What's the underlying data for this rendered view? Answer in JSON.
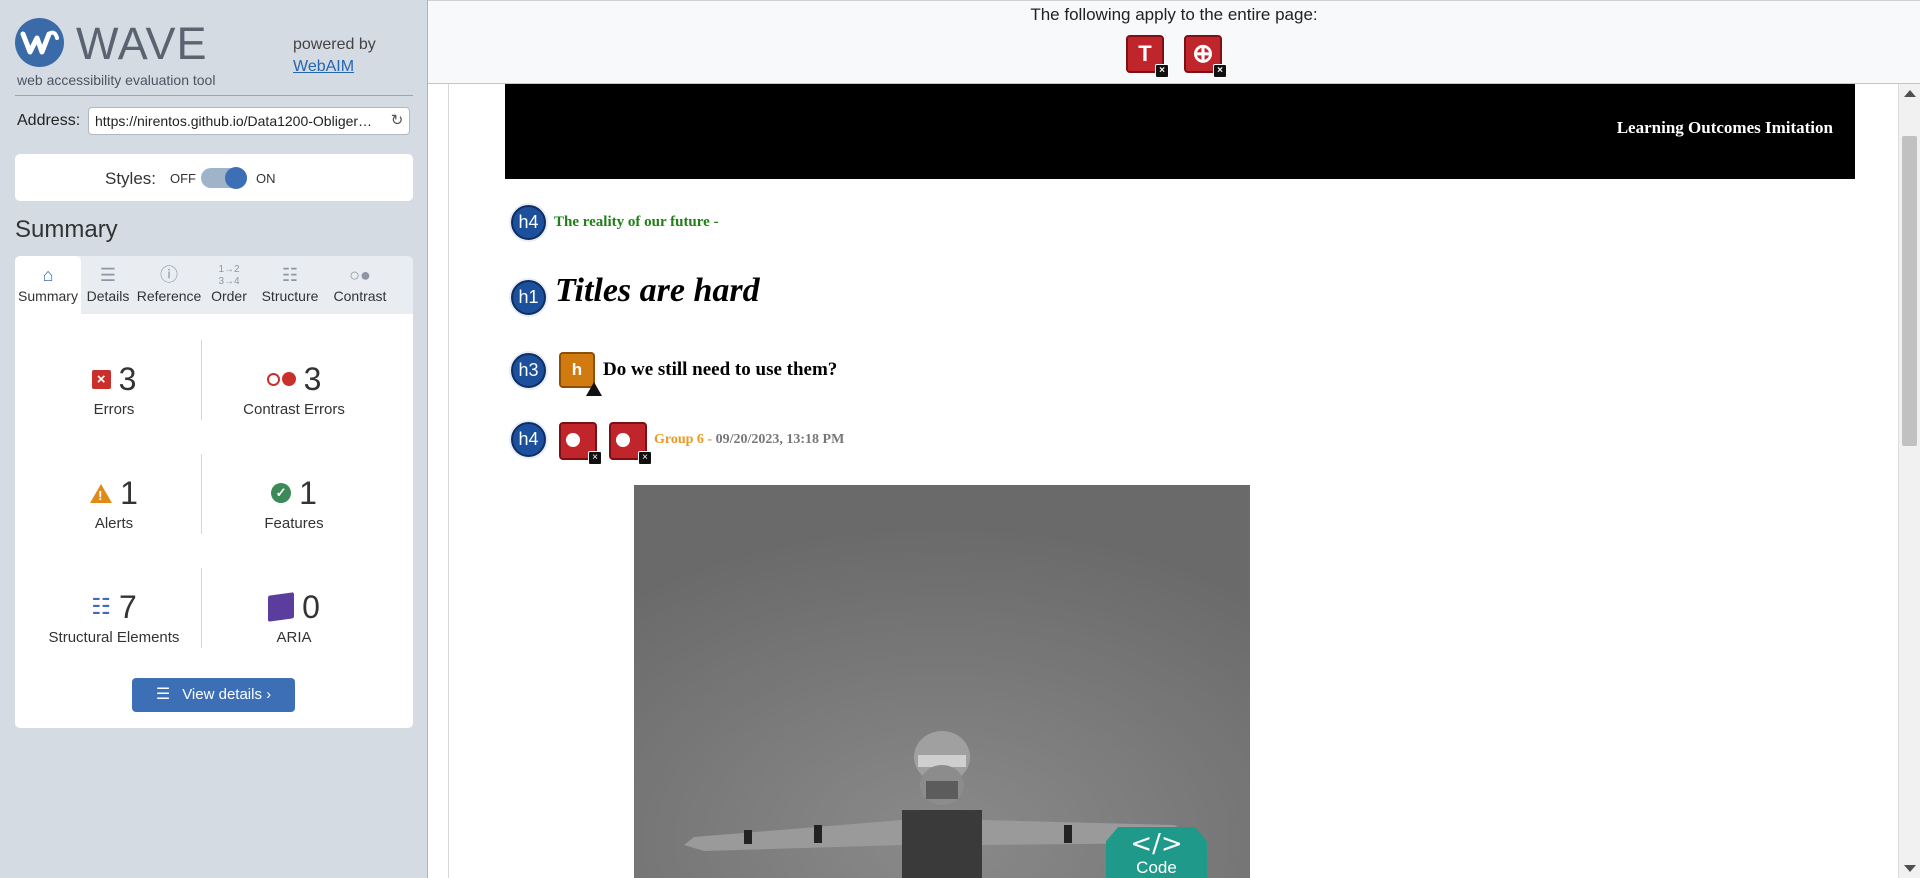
{
  "sidebar": {
    "logo_alt": "wave-logo",
    "title": "WAVE",
    "subtitle": "web accessibility evaluation tool",
    "powered_by": "powered by",
    "powered_link": "WebAIM",
    "address_label": "Address:",
    "address_value": "https://nirentos.github.io/Data1200-Obliger…",
    "styles_label": "Styles:",
    "styles_off": "OFF",
    "styles_on": "ON",
    "styles_enabled": true,
    "summary_heading": "Summary",
    "tabs": [
      {
        "label": "Summary",
        "icon": "home-icon",
        "active": true
      },
      {
        "label": "Details",
        "icon": "list-icon",
        "active": false
      },
      {
        "label": "Reference",
        "icon": "info-icon",
        "active": false
      },
      {
        "label": "Order",
        "icon": "order-icon",
        "active": false
      },
      {
        "label": "Structure",
        "icon": "structure-icon",
        "active": false
      },
      {
        "label": "Contrast",
        "icon": "contrast-icon",
        "active": false
      }
    ],
    "stats": {
      "errors": {
        "count": "3",
        "label": "Errors"
      },
      "contrast_errors": {
        "count": "3",
        "label": "Contrast Errors"
      },
      "alerts": {
        "count": "1",
        "label": "Alerts"
      },
      "features": {
        "count": "1",
        "label": "Features"
      },
      "structural": {
        "count": "7",
        "label": "Structural Elements"
      },
      "aria": {
        "count": "0",
        "label": "ARIA"
      }
    },
    "view_details": "View details ›"
  },
  "topbar": {
    "text": "The following apply to the entire page:",
    "icons": [
      {
        "name": "missing-title-icon",
        "glyph": "T"
      },
      {
        "name": "language-missing-icon",
        "glyph": "⊕"
      }
    ]
  },
  "page": {
    "header_text": "Learning Outcomes Imitation",
    "headings": [
      {
        "level": "h4",
        "text": "The reality of our future -"
      },
      {
        "level": "h1",
        "text": "Titles are hard"
      },
      {
        "level": "h3",
        "text": "Do we still need to use them?"
      },
      {
        "level": "h4",
        "group": "Group 6 -",
        "date": "09/20/2023, 13:18 PM"
      }
    ],
    "alert_glyph": "h",
    "code_label": "Code",
    "code_symbol": "</>"
  },
  "colors": {
    "sidebar_bg": "#d4dbe3",
    "accent": "#3d6fb7",
    "error": "#c0252b",
    "alert": "#d07a10",
    "heading_green": "#1e7f14",
    "group_orange": "#e89a22"
  }
}
